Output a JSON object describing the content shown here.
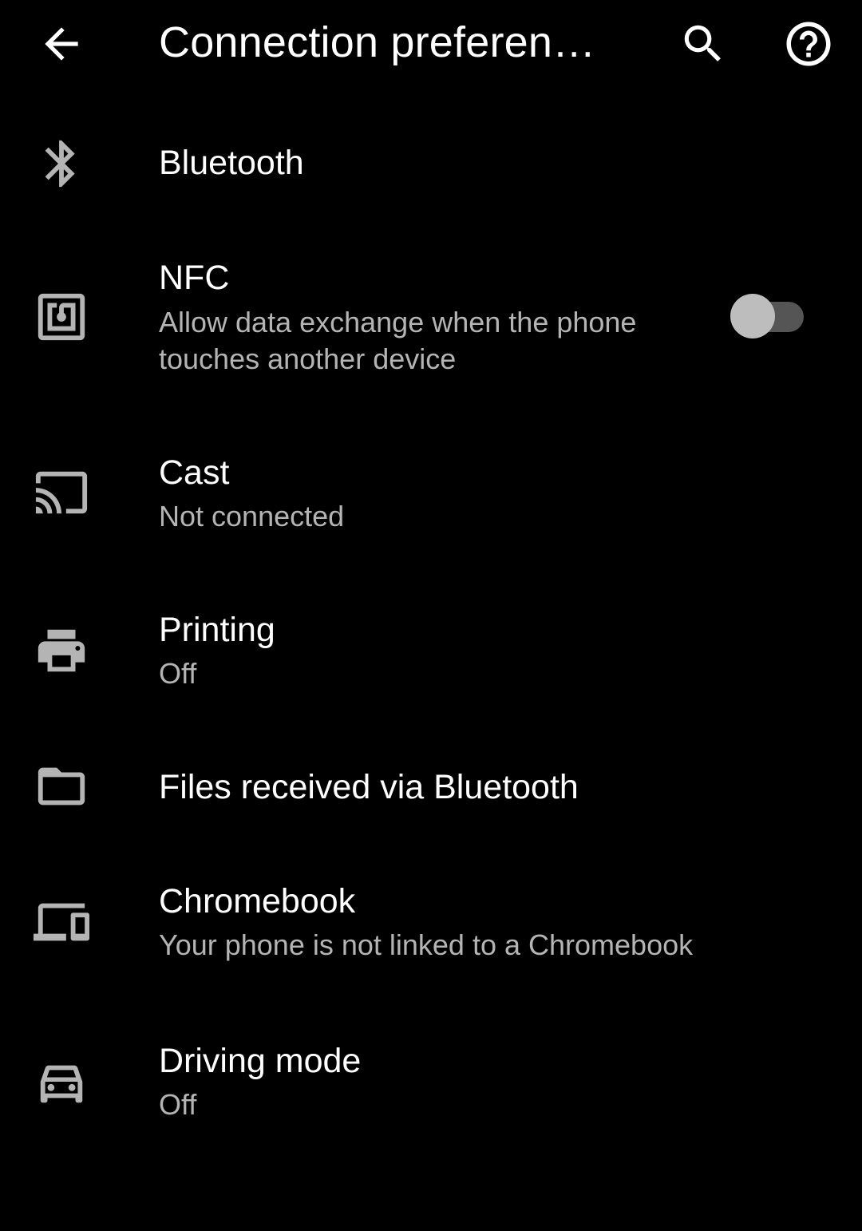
{
  "appbar": {
    "title": "Connection preferen…",
    "back_icon": "arrow-back-icon",
    "search_icon": "search-icon",
    "help_icon": "help-circle-icon"
  },
  "items": [
    {
      "title": "Bluetooth",
      "icon": "bluetooth-icon"
    },
    {
      "title": "NFC",
      "subtitle_line1": "Allow data exchange when the phone",
      "subtitle_line2": "touches another device",
      "icon": "nfc-icon",
      "toggle_on": false
    },
    {
      "title": "Cast",
      "subtitle": "Not connected",
      "icon": "cast-icon"
    },
    {
      "title": "Printing",
      "subtitle": "Off",
      "icon": "printer-icon"
    },
    {
      "title": "Files received via Bluetooth",
      "icon": "folder-icon"
    },
    {
      "title": "Chromebook",
      "subtitle": "Your phone is not linked to a Chromebook",
      "icon": "devices-icon"
    },
    {
      "title": "Driving mode",
      "subtitle": "Off",
      "icon": "car-icon"
    }
  ],
  "colors": {
    "background": "#000000",
    "icon": "#b4b4b4",
    "subtitle": "#b4b4b4",
    "toggle_thumb": "#bdbdbd",
    "toggle_track": "#555555"
  }
}
